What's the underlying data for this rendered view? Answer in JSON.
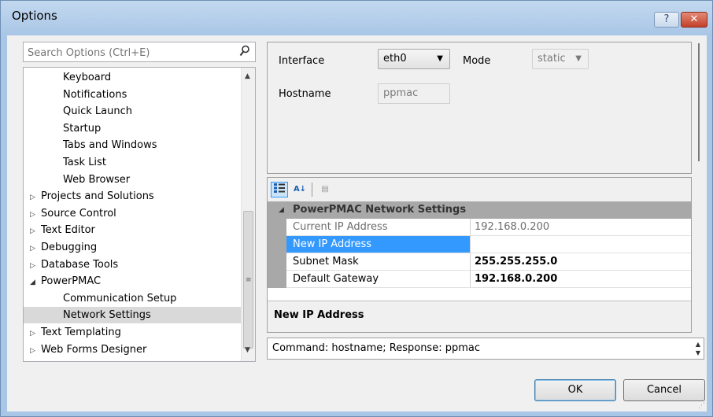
{
  "window": {
    "title": "Options",
    "help_glyph": "?",
    "close_glyph": "✕"
  },
  "search": {
    "placeholder": "Search Options (Ctrl+E)",
    "icon": "search-icon"
  },
  "tree": {
    "items": [
      {
        "label": "Keyboard",
        "indent": 2,
        "expander": "",
        "selected": false
      },
      {
        "label": "Notifications",
        "indent": 2,
        "expander": "",
        "selected": false
      },
      {
        "label": "Quick Launch",
        "indent": 2,
        "expander": "",
        "selected": false
      },
      {
        "label": "Startup",
        "indent": 2,
        "expander": "",
        "selected": false
      },
      {
        "label": "Tabs and Windows",
        "indent": 2,
        "expander": "",
        "selected": false
      },
      {
        "label": "Task List",
        "indent": 2,
        "expander": "",
        "selected": false
      },
      {
        "label": "Web Browser",
        "indent": 2,
        "expander": "",
        "selected": false
      },
      {
        "label": "Projects and Solutions",
        "indent": 1,
        "expander": "collapsed",
        "selected": false
      },
      {
        "label": "Source Control",
        "indent": 1,
        "expander": "collapsed",
        "selected": false
      },
      {
        "label": "Text Editor",
        "indent": 1,
        "expander": "collapsed",
        "selected": false
      },
      {
        "label": "Debugging",
        "indent": 1,
        "expander": "collapsed",
        "selected": false
      },
      {
        "label": "Database Tools",
        "indent": 1,
        "expander": "collapsed",
        "selected": false
      },
      {
        "label": "PowerPMAC",
        "indent": 1,
        "expander": "expanded",
        "selected": false
      },
      {
        "label": "Communication Setup",
        "indent": 2,
        "expander": "",
        "selected": false
      },
      {
        "label": "Network Settings",
        "indent": 2,
        "expander": "",
        "selected": true
      },
      {
        "label": "Text Templating",
        "indent": 1,
        "expander": "collapsed",
        "selected": false
      },
      {
        "label": "Web Forms Designer",
        "indent": 1,
        "expander": "collapsed",
        "selected": false
      }
    ]
  },
  "network": {
    "interface_label": "Interface",
    "interface_value": "eth0",
    "mode_label": "Mode",
    "mode_value": "static",
    "hostname_label": "Hostname",
    "hostname_value": "ppmac"
  },
  "propgrid": {
    "category": "PowerPMAC Network Settings",
    "rows": [
      {
        "name": "Current IP Address",
        "value": "192.168.0.200",
        "state": "readonly"
      },
      {
        "name": "New IP Address",
        "value": "",
        "state": "selected"
      },
      {
        "name": "Subnet Mask",
        "value": "255.255.255.0",
        "state": "bold"
      },
      {
        "name": "Default Gateway",
        "value": "192.168.0.200",
        "state": "bold"
      }
    ],
    "description_title": "New IP Address"
  },
  "status": {
    "text": "Command: hostname; Response: ppmac"
  },
  "buttons": {
    "ok": "OK",
    "cancel": "Cancel"
  }
}
